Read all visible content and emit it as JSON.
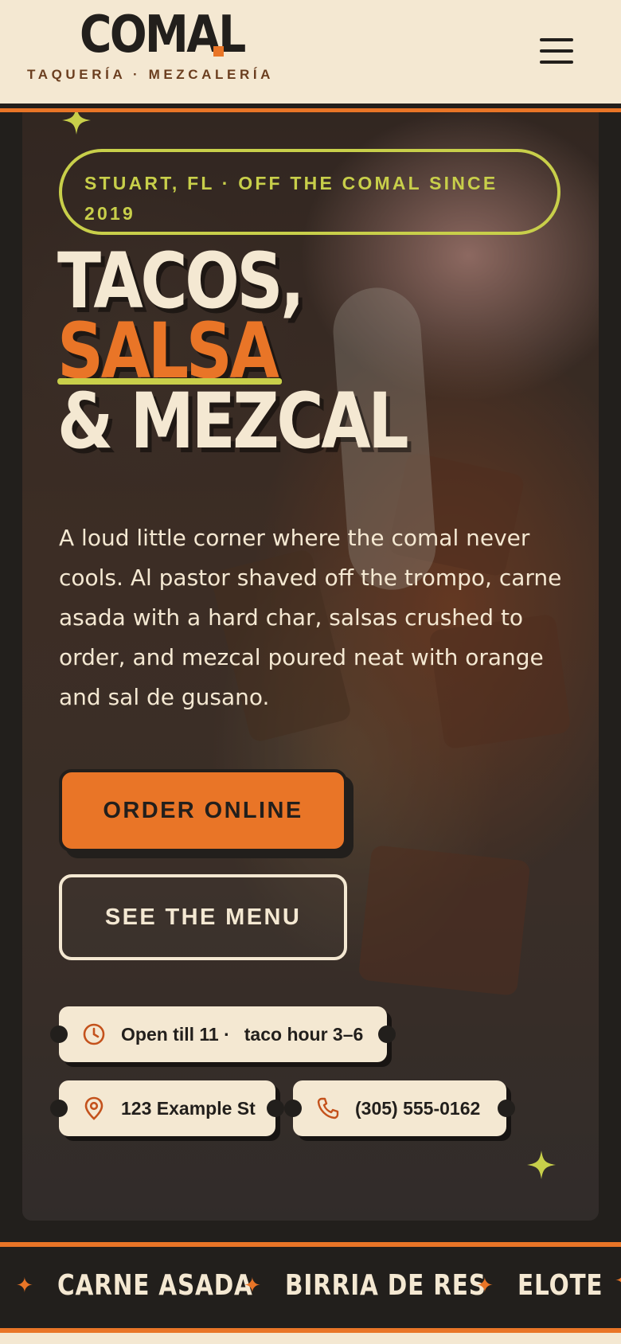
{
  "header": {
    "logo": "COMAL",
    "tagline": "TAQUERÍA · MEZCALERÍA",
    "menu_icon": "hamburger-menu-icon"
  },
  "hero": {
    "eyebrow": "STUART, FL · OFF THE COMAL SINCE 2019",
    "headline_line1": "TACOS,",
    "headline_accent": "SALSA",
    "headline_line3": "& MEZCAL",
    "lede": "A loud little corner where the comal never cools. Al pastor shaved off the trompo, carne asada with a hard char, salsas crushed to order, and mezcal poured neat with orange and sal de gusano.",
    "primary_cta": "ORDER ONLINE",
    "secondary_cta": "SEE THE MENU",
    "chips": {
      "hours": {
        "icon": "clock-icon",
        "label": "Open till 11 ·",
        "extra": "taco hour 3–6"
      },
      "address": {
        "icon": "map-pin-icon",
        "label": "123 Example St"
      },
      "phone": {
        "icon": "phone-icon",
        "label": "(305) 555-0162"
      }
    }
  },
  "ticker": {
    "items": [
      "CARNE ASADA",
      "BIRRIA DE RES",
      "ELOTE"
    ],
    "separator_icon": "star-icon"
  },
  "colors": {
    "cream": "#f4e8d2",
    "ink": "#221f1c",
    "orange": "#e97527",
    "lime": "#c8cf4a",
    "brown": "#6b3e1f"
  }
}
